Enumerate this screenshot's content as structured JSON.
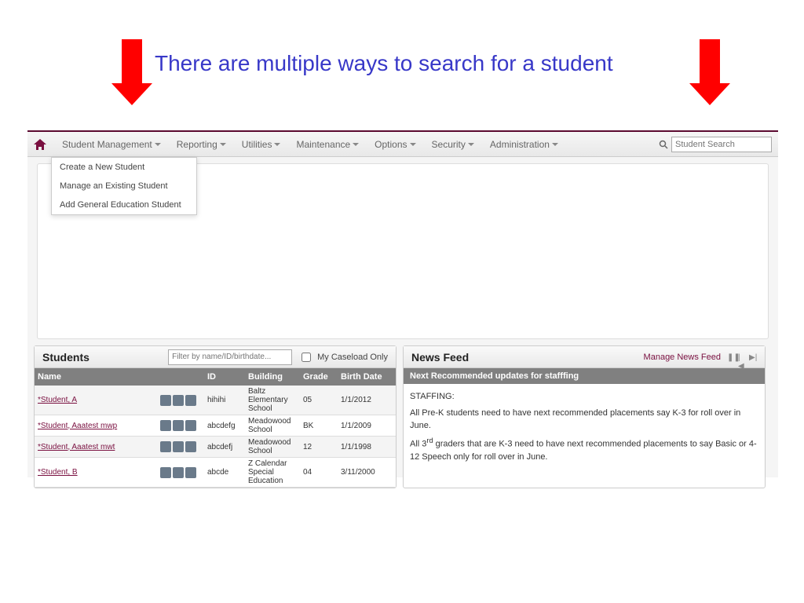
{
  "slide": {
    "title": "There are multiple ways to search for a student"
  },
  "nav": {
    "items": [
      "Student Management",
      "Reporting",
      "Utilities",
      "Maintenance",
      "Options",
      "Security",
      "Administration"
    ],
    "search_placeholder": "Student Search"
  },
  "dropdown": {
    "items": [
      "Create a New Student",
      "Manage an Existing Student",
      "Add General Education Student"
    ]
  },
  "students": {
    "title": "Students",
    "filter_placeholder": "Filter by name/ID/birthdate...",
    "caseload_label": "My Caseload Only",
    "columns": {
      "name": "Name",
      "id": "ID",
      "building": "Building",
      "grade": "Grade",
      "birth": "Birth Date"
    },
    "rows": [
      {
        "name": "*Student, A",
        "id": "hihihi",
        "building": "Baltz Elementary School",
        "grade": "05",
        "birth": "1/1/2012"
      },
      {
        "name": "*Student, Aaatest mwp",
        "id": "abcdefg",
        "building": "Meadowood School",
        "grade": "BK",
        "birth": "1/1/2009"
      },
      {
        "name": "*Student, Aaatest mwt",
        "id": "abcdefj",
        "building": "Meadowood School",
        "grade": "12",
        "birth": "1/1/1998"
      },
      {
        "name": "*Student, B",
        "id": "abcde",
        "building": "Z Calendar Special Education",
        "grade": "04",
        "birth": "3/11/2000"
      }
    ]
  },
  "news": {
    "title": "News Feed",
    "manage": "Manage News Feed",
    "subheader": "Next Recommended updates for stafffing",
    "heading": "STAFFING:",
    "p1": "All Pre-K students need to have next recommended placements say K-3 for roll over in June.",
    "p2a": "All 3",
    "p2sup": "rd",
    "p2b": " graders that are K-3 need to have next recommended placements to say Basic or 4-12 Speech only for roll over in June."
  }
}
